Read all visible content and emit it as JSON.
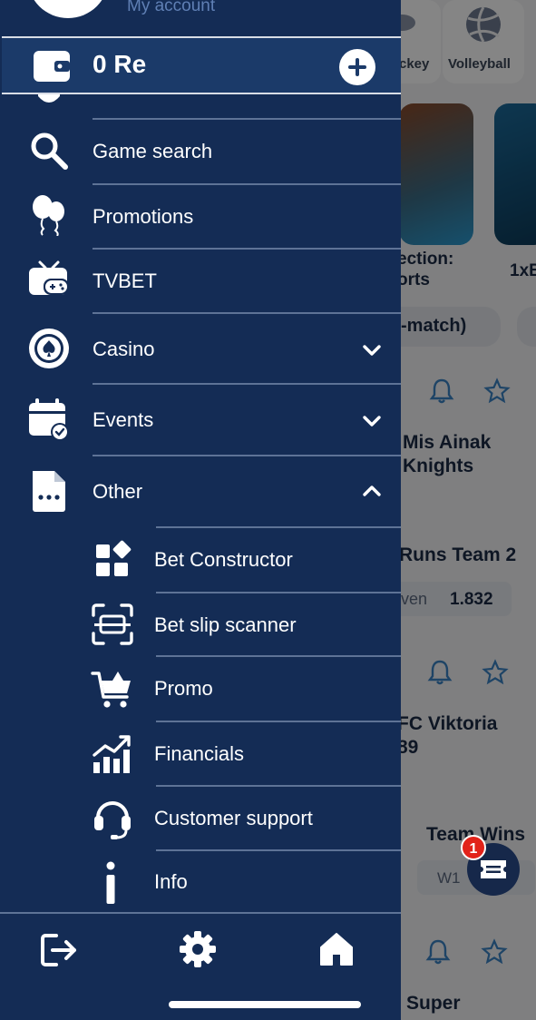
{
  "background": {
    "sports": [
      {
        "label": "ckey",
        "icon": "hockey-icon"
      },
      {
        "label": "Volleyball",
        "icon": "volleyball-icon"
      }
    ],
    "tile_labels": [
      "ection:",
      "orts",
      "1xB"
    ],
    "filter_pill": "-match)",
    "match1": {
      "line1": "Mis Ainak",
      "line2": "Knights"
    },
    "market1": {
      "title": "Runs Team 2",
      "outcome": "ven",
      "odds": "1.832"
    },
    "match2": {
      "line1": "FC Viktoria",
      "line2": "89"
    },
    "market2": {
      "title": "Team Wins",
      "outcome": "W1"
    },
    "match3": {
      "line1": "Super"
    }
  },
  "drawer": {
    "account": {
      "label": "My account"
    },
    "balance": {
      "amount": "0 Re",
      "wallet_icon": "wallet-icon",
      "add_icon": "plus-icon"
    },
    "menu": [
      {
        "label": "Game search",
        "icon": "search-icon"
      },
      {
        "label": "Promotions",
        "icon": "balloons-icon"
      },
      {
        "label": "TVBET",
        "icon": "tv-gamepad-icon"
      },
      {
        "label": "Casino",
        "icon": "casino-chip-icon",
        "expanded": false
      },
      {
        "label": "Events",
        "icon": "calendar-check-icon",
        "expanded": false
      },
      {
        "label": "Other",
        "icon": "document-dots-icon",
        "expanded": true
      }
    ],
    "submenu": [
      {
        "label": "Bet Constructor",
        "icon": "blocks-icon"
      },
      {
        "label": "Bet slip scanner",
        "icon": "scanner-icon"
      },
      {
        "label": "Promo",
        "icon": "shopping-cart-icon"
      },
      {
        "label": "Financials",
        "icon": "financial-chart-icon"
      },
      {
        "label": "Customer support",
        "icon": "headset-icon"
      },
      {
        "label": "Info",
        "icon": "info-icon"
      }
    ],
    "bottom_bar": {
      "logout_icon": "logout-icon",
      "settings_icon": "gear-icon",
      "home_icon": "home-icon"
    }
  },
  "coupon": {
    "count": "1",
    "icon": "ticket-icon"
  },
  "colors": {
    "drawer_bg": "#142c55",
    "balance_bg": "#1b3a69",
    "badge": "#e2231a"
  }
}
